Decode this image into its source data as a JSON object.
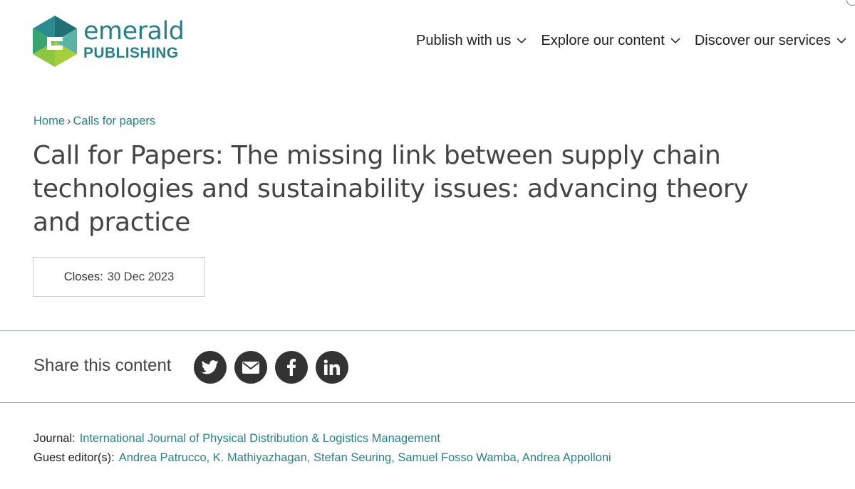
{
  "brand": {
    "word": "emerald",
    "sub": "PUBLISHING"
  },
  "nav": [
    {
      "label": "Publish with us"
    },
    {
      "label": "Explore our content"
    },
    {
      "label": "Discover our services"
    }
  ],
  "breadcrumb": {
    "home": "Home",
    "separator": "›",
    "current": "Calls for papers"
  },
  "title": "Call for Papers: The missing link between supply chain technologies and sustainability issues: advancing theory and practice",
  "closes": {
    "label": "Closes:",
    "date": "30 Dec 2023"
  },
  "share": {
    "label": "Share this content",
    "icons": [
      "twitter-icon",
      "email-icon",
      "facebook-icon",
      "linkedin-icon"
    ]
  },
  "journal": {
    "label": "Journal:",
    "value": "International Journal of Physical Distribution & Logistics Management"
  },
  "editors": {
    "label": "Guest editor(s):",
    "value": "Andrea Patrucco, K. Mathiyazhagan, Stefan Seuring, Samuel Fosso Wamba, Andrea Appolloni"
  },
  "colors": {
    "accent": "#2a7f87",
    "icon_bg": "#333333",
    "divider": "#9fb5b8"
  }
}
